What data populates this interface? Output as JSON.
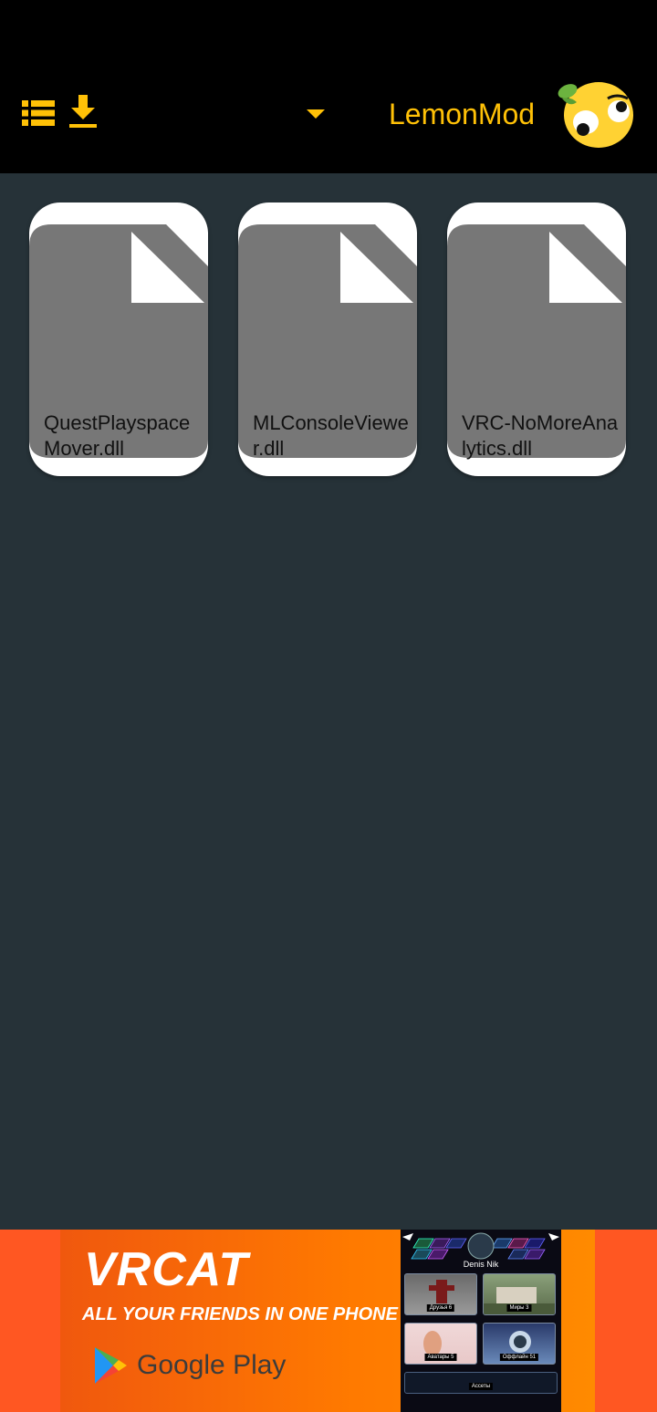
{
  "app": {
    "title": "LemonMod",
    "accent_color": "#FFC107",
    "toolbar_icons": [
      "list-view-icon",
      "download-icon",
      "dropdown-caret-icon"
    ]
  },
  "files": [
    {
      "name": "QuestPlayspaceMover.dll",
      "icon": "file-icon"
    },
    {
      "name": "MLConsoleViewer.dll",
      "icon": "file-icon"
    },
    {
      "name": "VRC-NoMoreAnalytics.dll",
      "icon": "file-icon"
    }
  ],
  "ad": {
    "title": "VRCAT",
    "tagline": "ALL YOUR FRIENDS IN ONE PHONE",
    "store_label": "Google Play",
    "phone": {
      "user": "Denis Nik",
      "tiles": [
        "Друзья 6",
        "Миры 3",
        "Аватары 5",
        "Оффлайн 51"
      ],
      "wide_tile": "Ассеты"
    }
  }
}
